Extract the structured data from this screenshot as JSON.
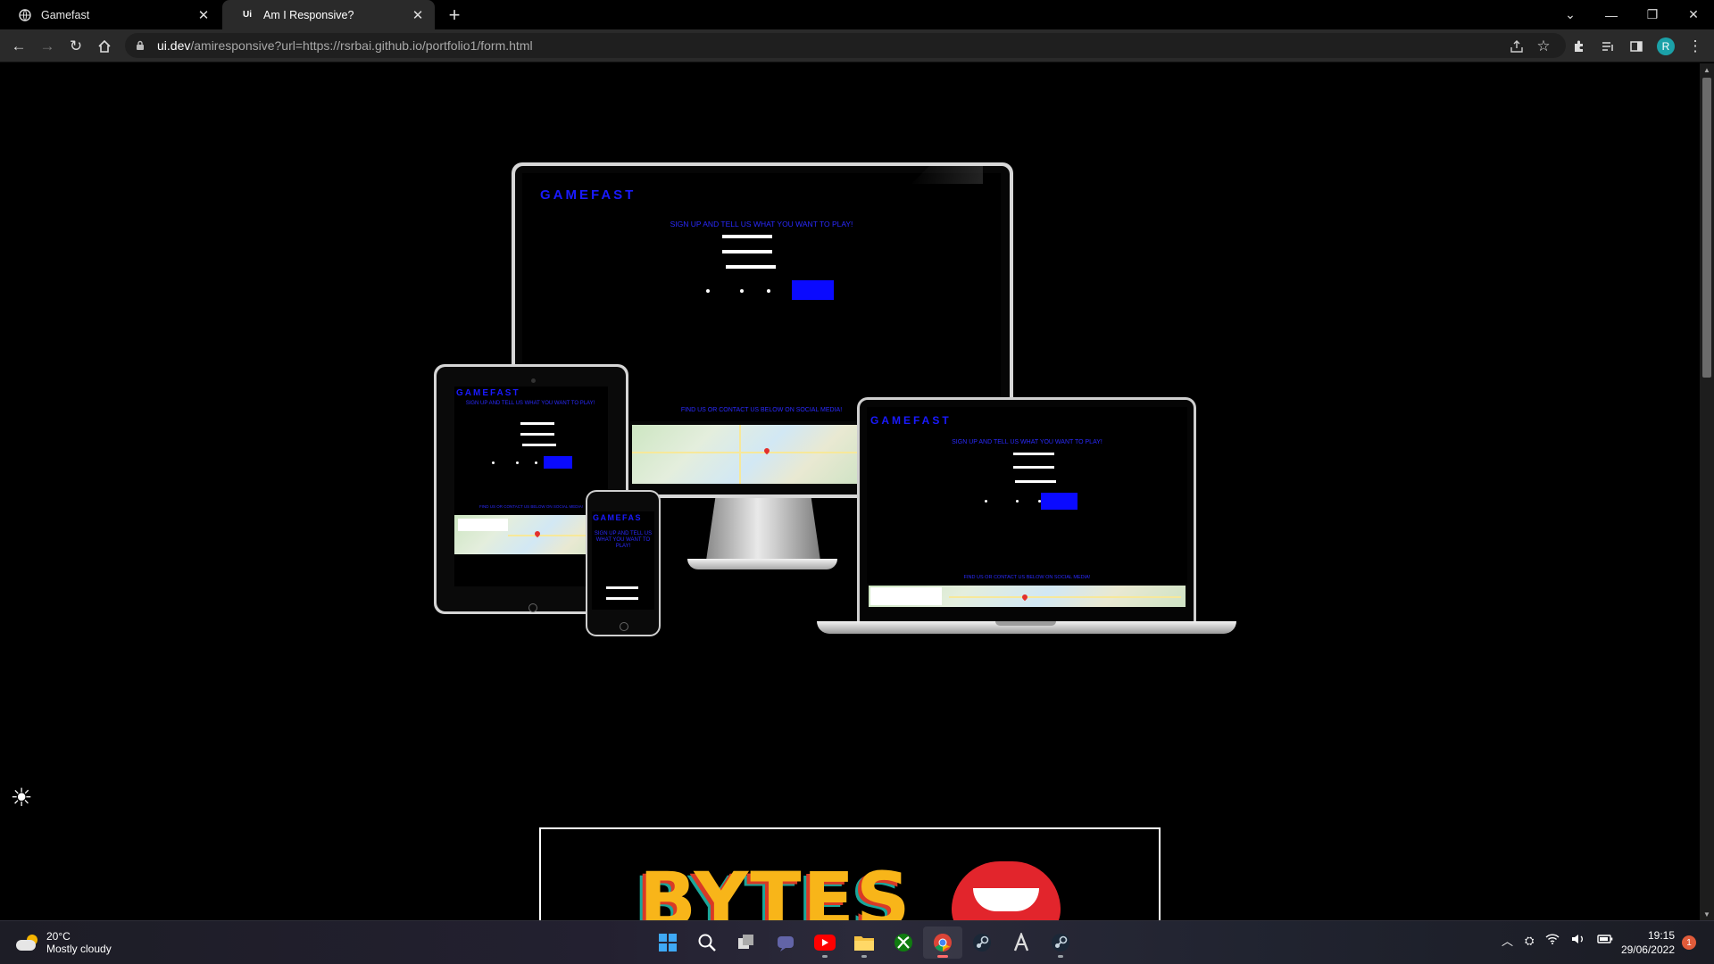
{
  "browser": {
    "tabs": [
      {
        "title": "Gamefast",
        "favicon": "globe-icon",
        "active": false
      },
      {
        "title": "Am I Responsive?",
        "favicon": "Ui",
        "active": true
      }
    ],
    "url_host": "ui.dev",
    "url_path": "/amiresponsive?url=https://rsrbai.github.io/portfolio1/form.html",
    "profile_initial": "R"
  },
  "gamefast": {
    "logo": "GAMEFAST",
    "logo_phone": "GAMEFAS",
    "heading": "SIGN UP AND TELL US WHAT YOU WANT TO PLAY!",
    "social_heading": "FIND US OR CONTACT US BELOW ON SOCIAL MEDIA!"
  },
  "theme_toggle_icon": "☀",
  "next_project": {
    "logo": "BYTES"
  },
  "taskbar": {
    "weather_temp": "20°C",
    "weather_condition": "Mostly cloudy",
    "time": "19:15",
    "date": "29/06/2022",
    "notification_count": "1",
    "apps": [
      "start",
      "search",
      "task-view",
      "teams-chat",
      "youtube",
      "file-explorer",
      "xbox",
      "chrome",
      "steam",
      "epic-games",
      "steam-2"
    ]
  }
}
